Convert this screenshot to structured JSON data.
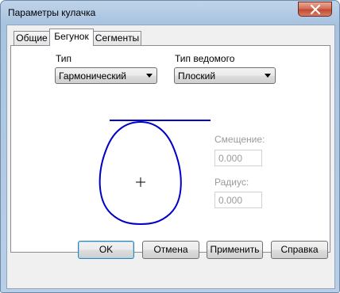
{
  "window": {
    "title": "Параметры кулачка"
  },
  "tabs": [
    {
      "label": "Общие",
      "active": false
    },
    {
      "label": "Бегунок",
      "active": true
    },
    {
      "label": "Сегменты",
      "active": false
    }
  ],
  "panel": {
    "type_label": "Тип",
    "type_value": "Гармонический",
    "follower_type_label": "Тип ведомого",
    "follower_type_value": "Плоский",
    "offset_label": "Смещение:",
    "offset_value": "0.000",
    "radius_label": "Радиус:",
    "radius_value": "0.000"
  },
  "buttons": {
    "ok": "OK",
    "cancel": "Отмена",
    "apply": "Применить",
    "help": "Справка"
  },
  "colors": {
    "diagram_stroke": "#0000c8"
  }
}
